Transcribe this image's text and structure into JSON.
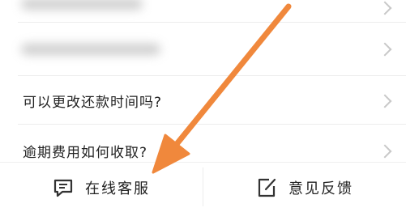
{
  "faq": {
    "items": [
      {
        "label": "",
        "blurred": true
      },
      {
        "label": "",
        "blurred": true
      },
      {
        "label": "可以更改还款时间吗?",
        "blurred": false
      },
      {
        "label": "逾期费用如何收取?",
        "blurred": false
      }
    ]
  },
  "bottom_bar": {
    "customer_service_label": "在线客服",
    "customer_service_icon": "chat-bubble-icon",
    "feedback_label": "意见反馈",
    "feedback_icon": "edit-note-icon"
  },
  "annotation": {
    "arrow_color": "#F0883C",
    "arrow_points_to": "customer_service_button"
  }
}
